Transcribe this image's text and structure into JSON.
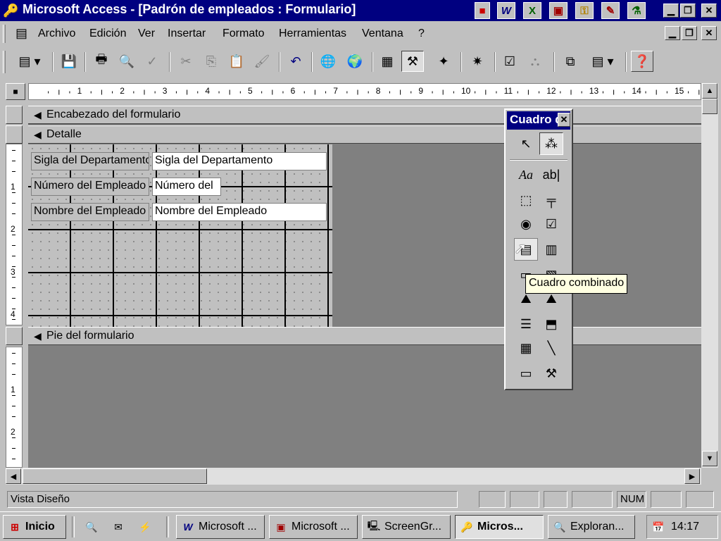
{
  "window": {
    "title": "Microsoft Access - [Padrón de empleados : Formulario]",
    "app_icons": [
      "access-key-icon",
      "word-icon",
      "excel-icon",
      "powerpoint-icon",
      "key-icon",
      "notepad-icon",
      "scientist-icon"
    ],
    "controls": [
      "minimize-icon",
      "restore-icon",
      "close-icon"
    ]
  },
  "menu": {
    "items": [
      "Archivo",
      "Edición",
      "Ver",
      "Insertar",
      "Formato",
      "Herramientas",
      "Ventana",
      "?"
    ]
  },
  "ruler": {
    "h_ticks": [
      "1",
      "2",
      "3",
      "4",
      "5",
      "6",
      "7",
      "8",
      "9",
      "10",
      "11",
      "12",
      "13",
      "14",
      "15"
    ],
    "v_ticks": [
      "1",
      "2",
      "3",
      "4",
      "1",
      "2"
    ]
  },
  "sections": {
    "header": "Encabezado del formulario",
    "detail": "Detalle",
    "footer": "Pie del formulario"
  },
  "form_fields": [
    {
      "label": "Sigla del Departamento",
      "value": "Sigla del Departamento"
    },
    {
      "label": "Número del Empleado",
      "value": "Número del"
    },
    {
      "label": "Nombre del Empleado",
      "value": "Nombre del Empleado"
    }
  ],
  "toolbox": {
    "title": "Cuadro de herramientas",
    "tooltip": "Cuadro combinado",
    "tools": [
      "Aa",
      "ab|"
    ]
  },
  "status": {
    "mode": "Vista Diseño",
    "num": "NUM"
  },
  "taskbar": {
    "start": "Inicio",
    "tasks": [
      "Microsoft ...",
      "Microsoft ...",
      "ScreenGr...",
      "Micros...",
      "Exploran..."
    ],
    "time": "14:17"
  }
}
